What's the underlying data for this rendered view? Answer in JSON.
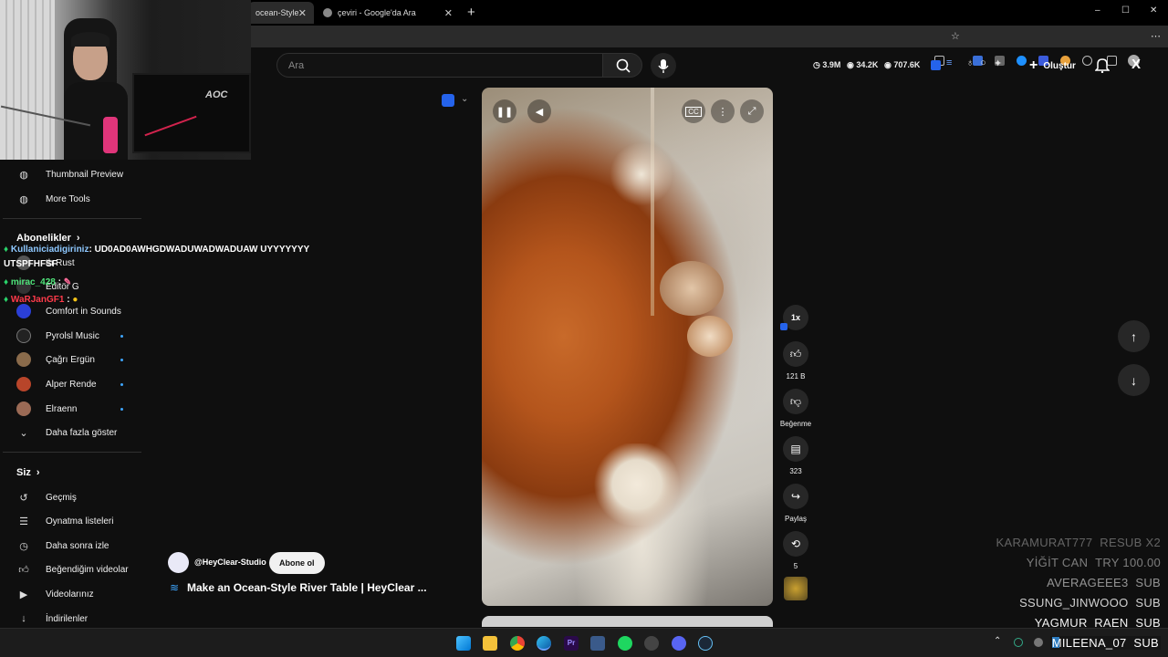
{
  "browser": {
    "tabs": [
      {
        "title": "ocean-Style Rive",
        "active": true
      },
      {
        "title": "çeviri - Google'da Ara",
        "active": false
      }
    ],
    "new_tab": "+",
    "window_controls": [
      "–",
      "☐",
      "✕"
    ]
  },
  "header": {
    "search_placeholder": "Ara",
    "stats": [
      {
        "icon": "clock-icon",
        "value": "3.9M"
      },
      {
        "icon": "eye-icon",
        "value": "34.2K"
      },
      {
        "icon": "eye-icon",
        "value": "707.6K"
      }
    ],
    "create_label": "Oluştur"
  },
  "sidebar": {
    "top_items": [
      {
        "label": "Thumbnail Preview",
        "icon": "tool-icon"
      },
      {
        "label": "More Tools",
        "icon": "tool-icon"
      }
    ],
    "subscriptions_title": "Abonelikler",
    "subscriptions": [
      {
        "label": "th Rust",
        "dot": false
      },
      {
        "label": "Editör G",
        "dot": false
      },
      {
        "label": "Comfort in Sounds",
        "dot": false
      },
      {
        "label": "Pyrolsl Music",
        "dot": true
      },
      {
        "label": "Çağrı Ergün",
        "dot": true
      },
      {
        "label": "Alper Rende",
        "dot": true
      },
      {
        "label": "Elraenn",
        "dot": true
      }
    ],
    "show_more": "Daha fazla göster",
    "you_title": "Siz",
    "you_items": [
      {
        "label": "Geçmiş",
        "icon": "history-icon"
      },
      {
        "label": "Oynatma listeleri",
        "icon": "playlist-icon"
      },
      {
        "label": "Daha sonra izle",
        "icon": "clock-icon"
      },
      {
        "label": "Beğendiğim videolar",
        "icon": "like-icon"
      },
      {
        "label": "Videolarınız",
        "icon": "video-icon"
      },
      {
        "label": "İndirilenler",
        "icon": "download-icon"
      }
    ]
  },
  "chat": [
    {
      "user": "Kullaniciadigiriniz",
      "sep": ":",
      "message": "UD0AD0AWHGDWADUWADWADUAW UYYYYYYY",
      "color": "#8ec8ff"
    },
    {
      "user": "",
      "sep": "",
      "message": "UTSPFHFSF",
      "color": "#ffffff"
    },
    {
      "user": "mirac_428",
      "sep": ":",
      "message": "",
      "color": "#4fe37a"
    },
    {
      "user": "WaRJanGF1",
      "sep": ":",
      "message": "",
      "color": "#ff3a4a"
    }
  ],
  "short": {
    "channel": "@HeyClear-Studio",
    "subscribe": "Abone ol",
    "title": "Make an Ocean-Style River Table | HeyClear ..."
  },
  "actions": {
    "speed": "1x",
    "likes": "121 B",
    "dislike": "Beğenme",
    "comments": "323",
    "share": "Paylaş",
    "remix": "5"
  },
  "alerts": [
    {
      "name": "KARAMURAT777",
      "event": "RESUB X2",
      "opacity": 0.35
    },
    {
      "name": "YİĞİT CAN",
      "event": "TRY 100.00",
      "opacity": 0.45
    },
    {
      "name": "AVERAGEEE3",
      "event": "SUB",
      "opacity": 0.55
    },
    {
      "name": "SSUNG_JINWOOO",
      "event": "SUB",
      "opacity": 0.8
    },
    {
      "name": "YAGMUR_RAEN",
      "event": "SUB",
      "opacity": 0.95
    },
    {
      "name": "MILEENA_07",
      "event": "SUB",
      "opacity": 1.0
    }
  ]
}
